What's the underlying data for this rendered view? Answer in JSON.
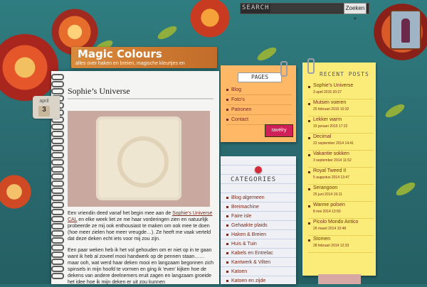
{
  "site": {
    "title": "Magic Colours",
    "description": "alles over haken en breien, magische kleurtjes en"
  },
  "search": {
    "label": "SEARCH",
    "button": "Zoeken »"
  },
  "post": {
    "title": "Sophie’s Universe",
    "date": {
      "month": "april",
      "day": "3"
    },
    "paragraph1_before": "Een vriendin deed vanaf het begin mee aan de ",
    "paragraph1_link": "Sophie’s Universe CAL",
    "paragraph1_after": " en elke week liet ze me haar vorderingen zien en natuurlijk probeerde ze mij ook enthousiast te maken om ook mee te doen (hoe meer zielen hoe meer vreugde…). Ze heeft me vaak verteld dat deze deken echt iets voor mij zou zijn.",
    "paragraph2": "Een paar weken heb ik het vol gehouden om er niet op in te gaan want ik heb al zoveel mooi handwerk op de pennen staan…… maar ooh, wat werd haar deken mooi en langzaam begonnen zich spinsels in mijn hoofd te vormen en ging ik 'even' kijken hoe de dekens van andere deelnemers eruit zagen en langzaam groeide het idee hoe ik mijn deken er uit zou kunnen"
  },
  "pages": {
    "heading": "PAGES",
    "items": [
      "Blog",
      "Foto's",
      "Patronen",
      "Contact"
    ],
    "ravelry": "ravelry"
  },
  "categories": {
    "heading": "CATEGORIES",
    "items": [
      "Blog algemeen",
      "Breimachine",
      "Faire isle",
      "Gehaakte plaids",
      "Haken & Breien",
      "Huis & Tuin",
      "Kabels en Entrelac",
      "Kantwerk & Vilten",
      "Katoen",
      "Katoen en zijde"
    ]
  },
  "recent": {
    "heading": "RECENT POSTS",
    "items": [
      {
        "title": "Sophie’s Universe",
        "date": "3 april 2015 20:27"
      },
      {
        "title": "Mutsen voeren",
        "date": "25 februari 2015 10:32"
      },
      {
        "title": "Lekker warm",
        "date": "15 januari 2015 17:22"
      },
      {
        "title": "Decimal",
        "date": "22 september 2014 14:41"
      },
      {
        "title": "Vakantie sokken",
        "date": "3 september 2014 11:52"
      },
      {
        "title": "Royal Tweed II",
        "date": "5 augustus 2014 13:47"
      },
      {
        "title": "Serangoon",
        "date": "25 juni 2014 19:11"
      },
      {
        "title": "Warme polsen",
        "date": "8 mei 2014 13:50"
      },
      {
        "title": "Picolo Mondo Antico",
        "date": "26 maart 2014 10:48"
      },
      {
        "title": "Stomen",
        "date": "28 februari 2014 12:33"
      }
    ]
  }
}
